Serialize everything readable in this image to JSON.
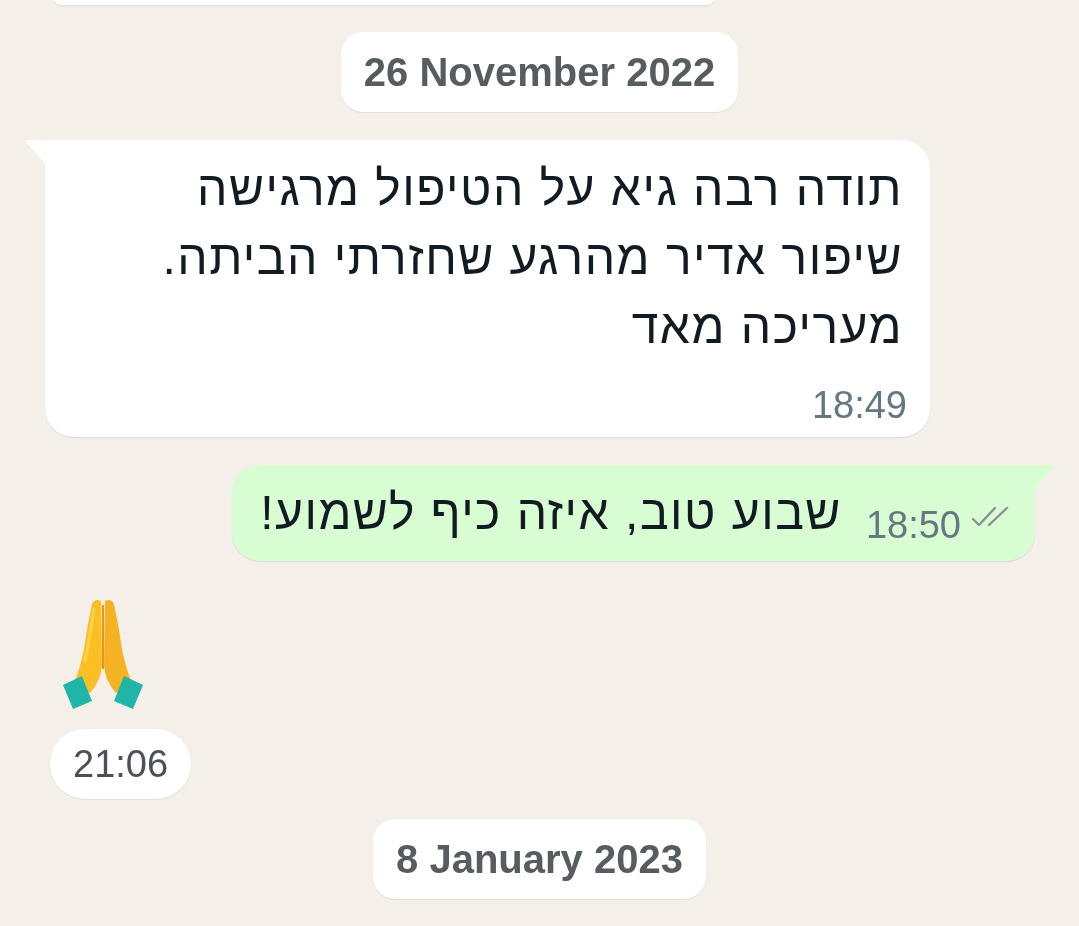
{
  "chat": {
    "items": [
      {
        "kind": "clipped",
        "outgoing": false
      },
      {
        "kind": "date",
        "label": "26 November 2022"
      },
      {
        "kind": "text",
        "outgoing": false,
        "text": "תודה רבה גיא על הטיפול מרגישה\nשיפור אדיר מהרגע שחזרתי הביתה.\nמעריכה מאד",
        "time": "18:49"
      },
      {
        "kind": "text",
        "outgoing": true,
        "text": "שבוע טוב, איזה כיף לשמוע!",
        "time": "18:50",
        "delivered": true,
        "read": false
      },
      {
        "kind": "emoji",
        "outgoing": false,
        "time": "21:06"
      },
      {
        "kind": "date",
        "label": "8 January 2023"
      }
    ]
  }
}
